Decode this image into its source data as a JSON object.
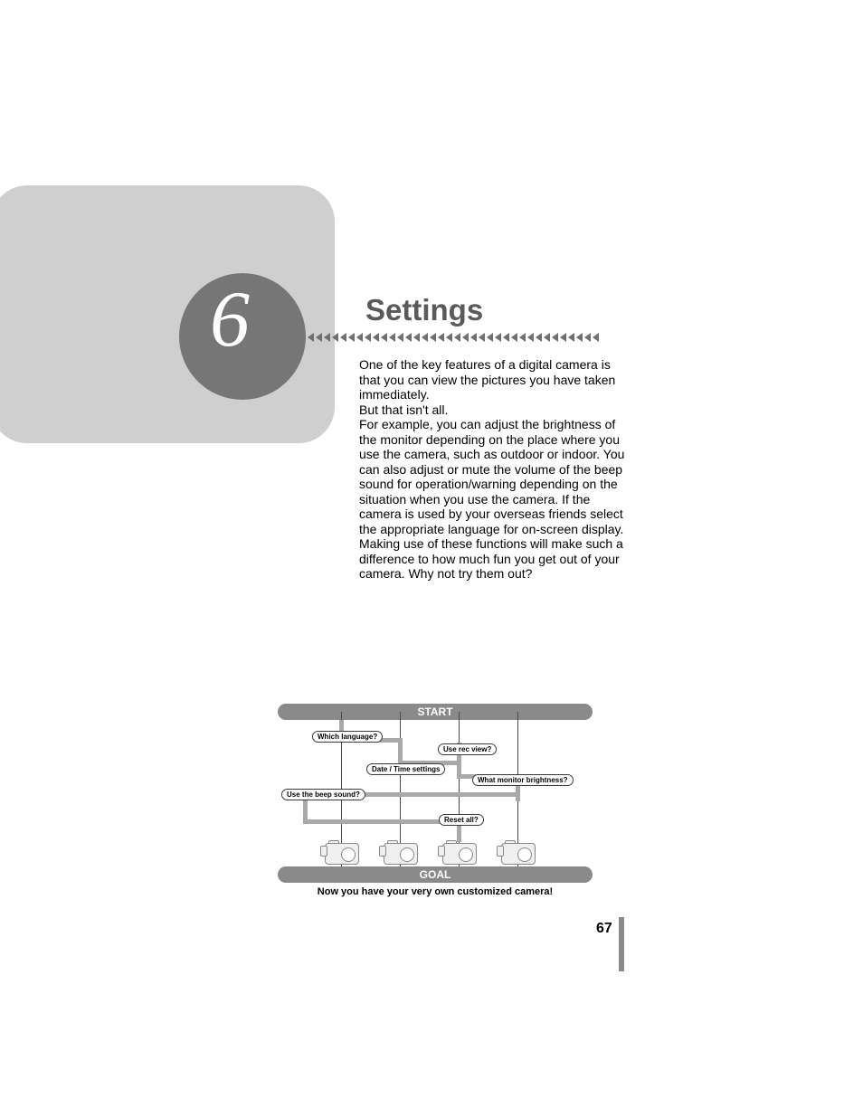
{
  "chapter": {
    "number": "6",
    "title": "Settings"
  },
  "body": {
    "p1": "One of the key features of a digital camera is that you can view the pictures you have taken immediately.",
    "p2": "But that isn't all.",
    "p3": "For example, you can adjust the brightness of the monitor depending on the place where you use the camera, such as outdoor or indoor. You can also adjust or mute the volume of the beep sound for operation/warning depending on the situation when you use the camera. If the camera is used by your overseas friends select the appropriate language for on-screen display. Making use of these functions will make such a difference to how much fun you get out of your camera. Why not try them out?"
  },
  "flowchart": {
    "start": "START",
    "goal": "GOAL",
    "caption": "Now you have your very own customized camera!",
    "nodes": {
      "language": "Which language?",
      "recview": "Use rec view?",
      "datetime": "Date / Time settings",
      "brightness": "What monitor brightness?",
      "beep": "Use the beep sound?",
      "reset": "Reset all?"
    }
  },
  "page_number": "67"
}
